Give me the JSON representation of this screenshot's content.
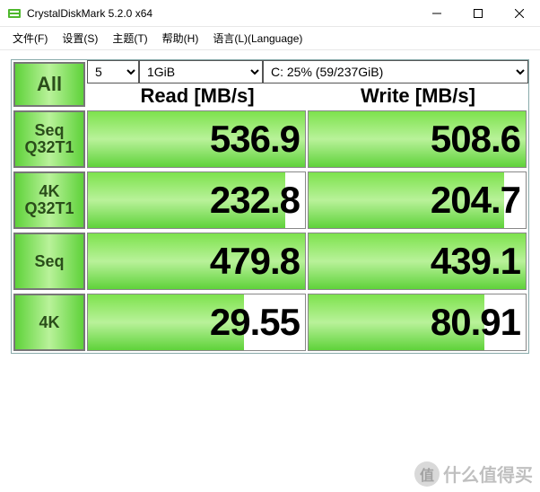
{
  "window": {
    "title": "CrystalDiskMark 5.2.0 x64"
  },
  "menu": {
    "file": "文件(F)",
    "settings": "设置(S)",
    "theme": "主题(T)",
    "help": "帮助(H)",
    "language": "语言(L)(Language)"
  },
  "controls": {
    "all_label": "All",
    "runs": "5",
    "test_size": "1GiB",
    "drive": "C: 25% (59/237GiB)"
  },
  "headers": {
    "read": "Read [MB/s]",
    "write": "Write [MB/s]"
  },
  "tests": [
    {
      "label1": "Seq",
      "label2": "Q32T1",
      "read": "536.9",
      "write": "508.6",
      "read_fill": 100,
      "write_fill": 100
    },
    {
      "label1": "4K",
      "label2": "Q32T1",
      "read": "232.8",
      "write": "204.7",
      "read_fill": 91,
      "write_fill": 90
    },
    {
      "label1": "Seq",
      "label2": "",
      "read": "479.8",
      "write": "439.1",
      "read_fill": 100,
      "write_fill": 100
    },
    {
      "label1": "4K",
      "label2": "",
      "read": "29.55",
      "write": "80.91",
      "read_fill": 72,
      "write_fill": 81
    }
  ],
  "watermark": {
    "text": "什么值得买"
  }
}
